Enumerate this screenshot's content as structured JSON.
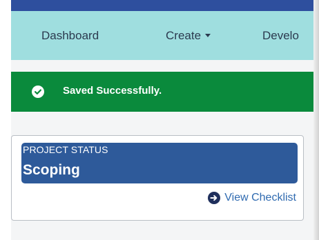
{
  "nav": {
    "items": [
      {
        "label": "Dashboard"
      },
      {
        "label": "Create"
      },
      {
        "label": "Develo"
      }
    ]
  },
  "alert": {
    "message": "Saved Successfully.",
    "icon": "check-circle-icon",
    "color": "#0a8a3c"
  },
  "project": {
    "status_label": "PROJECT STATUS",
    "status_value": "Scoping",
    "checklist_link": "View Checklist",
    "link_icon": "arrow-circle-right-icon"
  },
  "colors": {
    "topbar": "#2e4f9e",
    "navbar": "#9fdedf",
    "status_box": "#2e5a9a",
    "link": "#2f6ab0"
  }
}
